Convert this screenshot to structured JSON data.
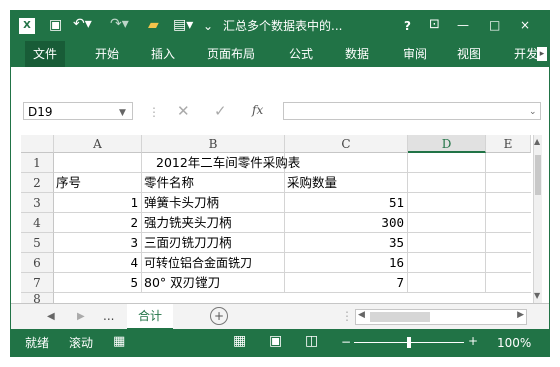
{
  "title_bar": {
    "app_icon": "excel-icon",
    "title": "汇总多个数据表中的...",
    "help": "?",
    "controls": [
      "—",
      "□",
      "×"
    ]
  },
  "ribbon_tabs": [
    "文件",
    "开始",
    "插入",
    "页面布局",
    "公式",
    "数据",
    "审阅",
    "视图",
    "开发"
  ],
  "formula_bar": {
    "name_box": "D19",
    "fx": "fx",
    "formula": ""
  },
  "columns": [
    "A",
    "B",
    "C",
    "D",
    "E"
  ],
  "rows": [
    {
      "n": "1",
      "a": "",
      "b": "2012年二车间零件采购表",
      "c": ""
    },
    {
      "n": "2",
      "a": "序号",
      "b": "零件名称",
      "c": "采购数量"
    },
    {
      "n": "3",
      "a": "1",
      "b": "弹簧卡头刀柄",
      "c": "51"
    },
    {
      "n": "4",
      "a": "2",
      "b": "强力铣夹头刀柄",
      "c": "300"
    },
    {
      "n": "5",
      "a": "3",
      "b": "三面刃铣刀刀柄",
      "c": "35"
    },
    {
      "n": "6",
      "a": "4",
      "b": "可转位铝合金面铣刀",
      "c": "16"
    },
    {
      "n": "7",
      "a": "5",
      "b": "80° 双刃镗刀",
      "c": "7"
    },
    {
      "n": "8",
      "a": "",
      "b": "",
      "c": ""
    }
  ],
  "sheet_tabs": {
    "more": "...",
    "active": "合计",
    "add": "+"
  },
  "status": {
    "ready": "就绪",
    "scroll": "滚动",
    "zoom": "100%",
    "zoom_level_fraction": 0.5
  }
}
